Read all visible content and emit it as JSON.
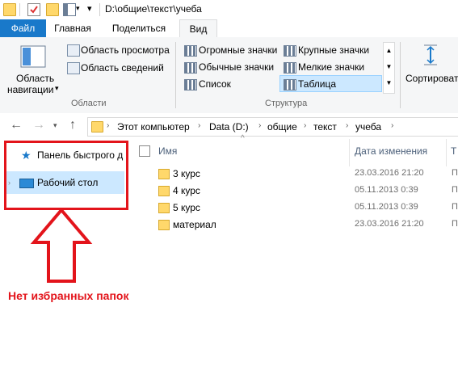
{
  "window": {
    "title_path": "D:\\общие\\текст\\учеба"
  },
  "tabs": {
    "file": "Файл",
    "home": "Главная",
    "share": "Поделиться",
    "view": "Вид"
  },
  "ribbon": {
    "nav_pane_label_line1": "Область",
    "nav_pane_label_line2": "навигации",
    "preview_pane": "Область просмотра",
    "details_pane": "Область сведений",
    "group_panes": "Области",
    "layouts": {
      "huge_icons": "Огромные значки",
      "large_icons": "Крупные значки",
      "medium_icons": "Обычные значки",
      "small_icons": "Мелкие значки",
      "list": "Список",
      "details": "Таблица"
    },
    "group_layout": "Структура",
    "sort_label": "Сортировать"
  },
  "address": {
    "crumbs": [
      "Этот компьютер",
      "Data (D:)",
      "общие",
      "текст",
      "учеба"
    ]
  },
  "navpane": {
    "quick_access": "Панель быстрого д",
    "desktop": "Рабочий стол"
  },
  "columns": {
    "name": "Имя",
    "modified": "Дата изменения",
    "type": "Т"
  },
  "files": [
    {
      "name": "3 курс",
      "date": "23.03.2016 21:20",
      "type": "П"
    },
    {
      "name": "4 курс",
      "date": "05.11.2013 0:39",
      "type": "П"
    },
    {
      "name": "5 курс",
      "date": "05.11.2013 0:39",
      "type": "П"
    },
    {
      "name": "материал",
      "date": "23.03.2016 21:20",
      "type": "П"
    }
  ],
  "annotation": {
    "text": "Нет избранных папок",
    "color": "#e3141b"
  },
  "colors": {
    "accent": "#1979ca",
    "selection": "#cce8ff"
  }
}
